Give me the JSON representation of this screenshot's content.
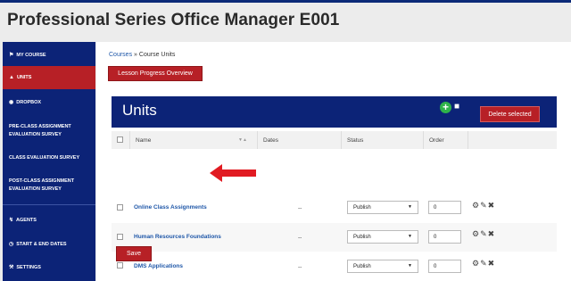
{
  "page_title": "Professional Series Office Manager E001",
  "colors": {
    "brand_navy": "#0c2377",
    "brand_red": "#b72026",
    "link_blue": "#1f57a8",
    "add_green": "#2fb24a"
  },
  "sidebar": {
    "items": [
      {
        "label": "MY COURSE",
        "icon": "flag-icon"
      },
      {
        "label": "UNITS",
        "icon": "units-icon",
        "active": true
      },
      {
        "label": "DROPBOX",
        "icon": "dropbox-icon"
      },
      {
        "label": "PRE-CLASS ASSIGNMENT EVALUATION SURVEY"
      },
      {
        "label": "CLASS EVALUATION SURVEY"
      },
      {
        "label": "POST-CLASS ASSIGNMENT EVALUATION SURVEY"
      },
      {
        "label": "AGENTS",
        "icon": "agents-icon"
      },
      {
        "label": "START & END DATES",
        "icon": "clock-icon"
      },
      {
        "label": "SETTINGS",
        "icon": "wrench-icon"
      }
    ]
  },
  "breadcrumb": {
    "root": "Courses",
    "separator": "»",
    "current": "Course Units"
  },
  "lesson_button": "Lesson Progress Overview",
  "units_header": {
    "title": "Units",
    "delete_button": "Delete selected",
    "add_icon": "plus-circle-icon",
    "cap_icon": "graduation-cap-icon"
  },
  "table": {
    "columns": [
      "Name",
      "Dates",
      "Status",
      "Order"
    ],
    "rows": [
      {
        "name": "Online Class Assignments",
        "dates": "--",
        "status": "Publish",
        "order": "0"
      },
      {
        "name": "Human Resources Foundations",
        "dates": "--",
        "status": "Publish",
        "order": "0"
      },
      {
        "name": "DMS Applications",
        "dates": "--",
        "status": "Publish",
        "order": "0"
      }
    ]
  },
  "save_button": "Save"
}
